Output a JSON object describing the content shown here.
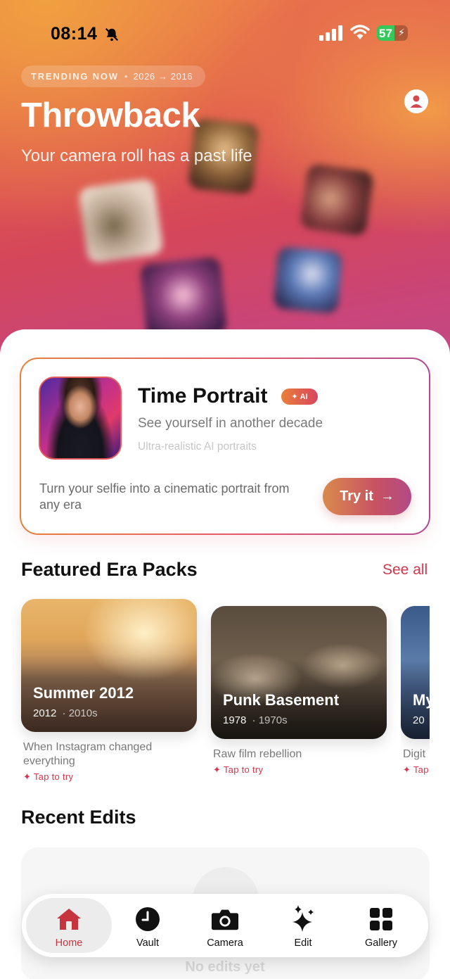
{
  "status_bar": {
    "time": "08:14",
    "battery": "57",
    "battery_level": 0.57
  },
  "hero": {
    "pill_label": "TRENDING NOW",
    "pill_range": "2026 → 2016",
    "title": "Throwback",
    "subtitle": "Your camera roll has a past life"
  },
  "time_portrait": {
    "title": "Time Portrait",
    "badge": "AI",
    "subtitle": "See yourself in another decade",
    "tagline": "Ultra-realistic AI portraits",
    "description": "Turn your selfie into a cinematic portrait from any era",
    "cta": "Try it"
  },
  "featured": {
    "title": "Featured Era Packs",
    "see_all": "See all",
    "packs": [
      {
        "name": "Summer 2012",
        "year": "2012",
        "decade": "2010s",
        "desc": "When Instagram changed everything",
        "tap": "Tap to try"
      },
      {
        "name": "Punk Basement",
        "year": "1978",
        "decade": "1970s",
        "desc": "Raw film rebellion",
        "tap": "Tap to try"
      },
      {
        "name": "My",
        "year": "20",
        "decade": "",
        "desc": "Digit",
        "tap": "Tap"
      }
    ]
  },
  "recent": {
    "title": "Recent Edits",
    "empty": "No edits yet"
  },
  "tabs": [
    {
      "label": "Home",
      "icon": "home-icon",
      "active": true
    },
    {
      "label": "Vault",
      "icon": "clock-icon"
    },
    {
      "label": "Camera",
      "icon": "camera-icon"
    },
    {
      "label": "Edit",
      "icon": "sparkles-icon"
    },
    {
      "label": "Gallery",
      "icon": "grid-icon"
    }
  ],
  "colors": {
    "accent": "#d2364a",
    "hero_top": "#ec7d4a",
    "hero_bottom": "#c04a86"
  }
}
